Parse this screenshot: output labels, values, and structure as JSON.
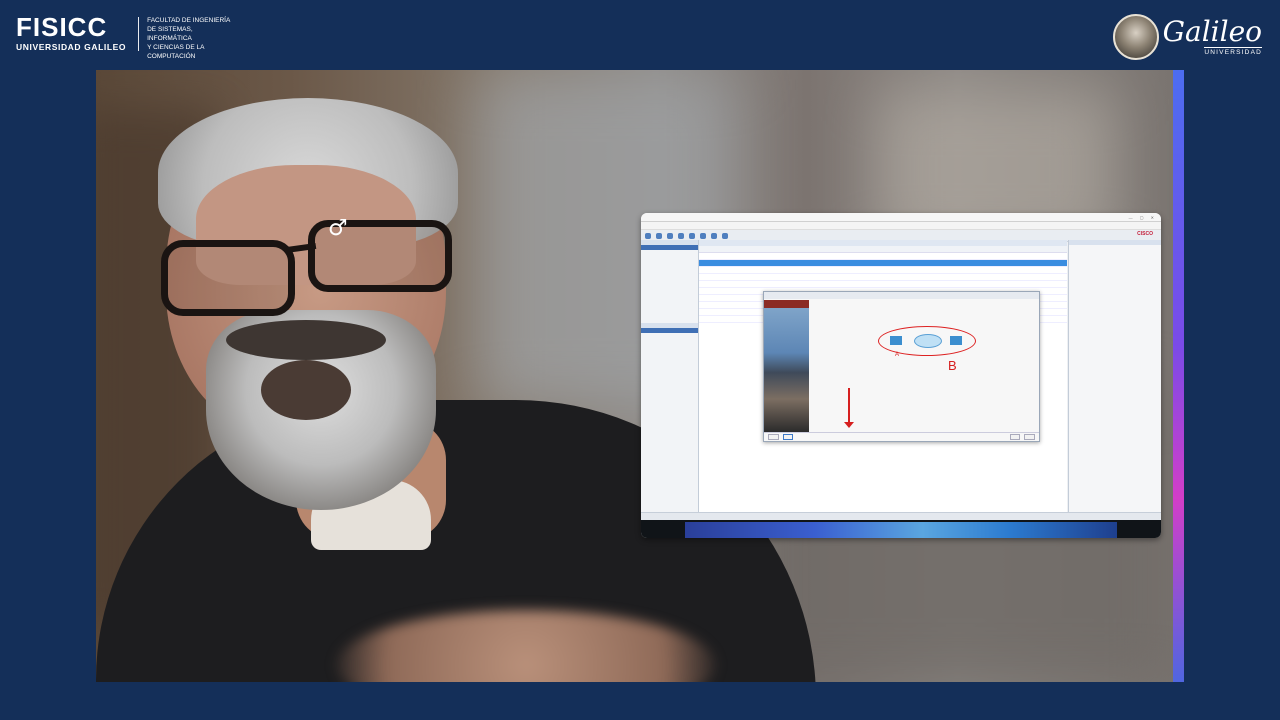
{
  "header": {
    "fisicc": "FISICC",
    "fisicc_sub": "UNIVERSIDAD GALILEO",
    "faculty_lines": [
      "FACULTAD DE INGENIERÍA",
      "DE SISTEMAS, INFORMÁTICA",
      "Y CIENCIAS DE LA",
      "COMPUTACIÓN"
    ],
    "galileo": "Galileo",
    "galileo_sub": "UNIVERSIDAD"
  },
  "video": {
    "cursor_glyph": "♂"
  },
  "screen": {
    "logo_text": "CISCO",
    "wizard_annotation_b": "B",
    "wizard_annotation_a": "A"
  },
  "colors": {
    "page_background": "#142f59",
    "annotation_red": "#d61f1f",
    "accent_gradient": [
      "#4c6df0",
      "#7a4be8",
      "#d23ec8",
      "#5066e0"
    ]
  }
}
